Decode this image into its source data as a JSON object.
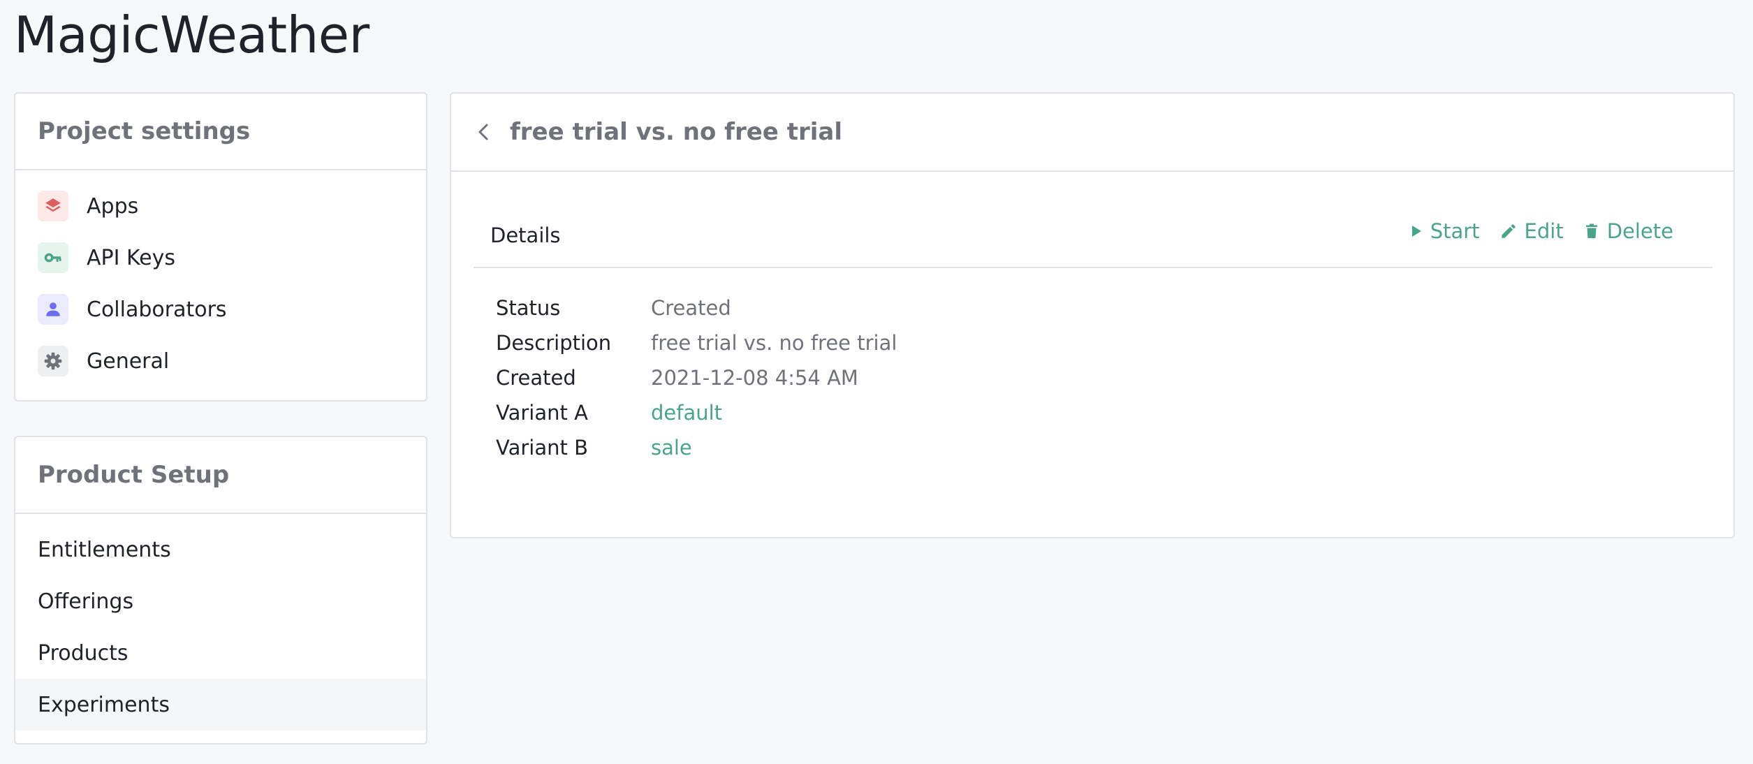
{
  "app": {
    "title": "MagicWeather"
  },
  "project_settings": {
    "title": "Project settings",
    "items": [
      {
        "label": "Apps",
        "icon": "layers-icon",
        "icon_color": "#e05d5d",
        "icon_bg": "#fde8e8"
      },
      {
        "label": "API Keys",
        "icon": "key-icon",
        "icon_color": "#4aa586",
        "icon_bg": "#e6f4ee"
      },
      {
        "label": "Collaborators",
        "icon": "person-icon",
        "icon_color": "#6c6cf0",
        "icon_bg": "#ebebfd"
      },
      {
        "label": "General",
        "icon": "gear-icon",
        "icon_color": "#6f7379",
        "icon_bg": "#eeeff1"
      }
    ]
  },
  "product_setup": {
    "title": "Product Setup",
    "items": [
      {
        "label": "Entitlements",
        "active": false
      },
      {
        "label": "Offerings",
        "active": false
      },
      {
        "label": "Products",
        "active": false
      },
      {
        "label": "Experiments",
        "active": true
      }
    ]
  },
  "experiment": {
    "title": "free trial vs. no free trial",
    "back_icon": "chevron-left-icon",
    "details": {
      "title": "Details",
      "actions": {
        "start_label": "Start",
        "edit_label": "Edit",
        "delete_label": "Delete"
      },
      "rows": [
        {
          "label": "Status",
          "value": "Created",
          "is_link": false
        },
        {
          "label": "Description",
          "value": "free trial vs. no free trial",
          "is_link": false
        },
        {
          "label": "Created",
          "value": "2021-12-08 4:54 AM",
          "is_link": false
        },
        {
          "label": "Variant A",
          "value": "default",
          "is_link": true
        },
        {
          "label": "Variant B",
          "value": "sale",
          "is_link": true
        }
      ]
    }
  },
  "colors": {
    "accent": "#4aa586",
    "muted_text": "#6f7379",
    "border": "#e1e3e7",
    "background": "#f7f8fa"
  }
}
